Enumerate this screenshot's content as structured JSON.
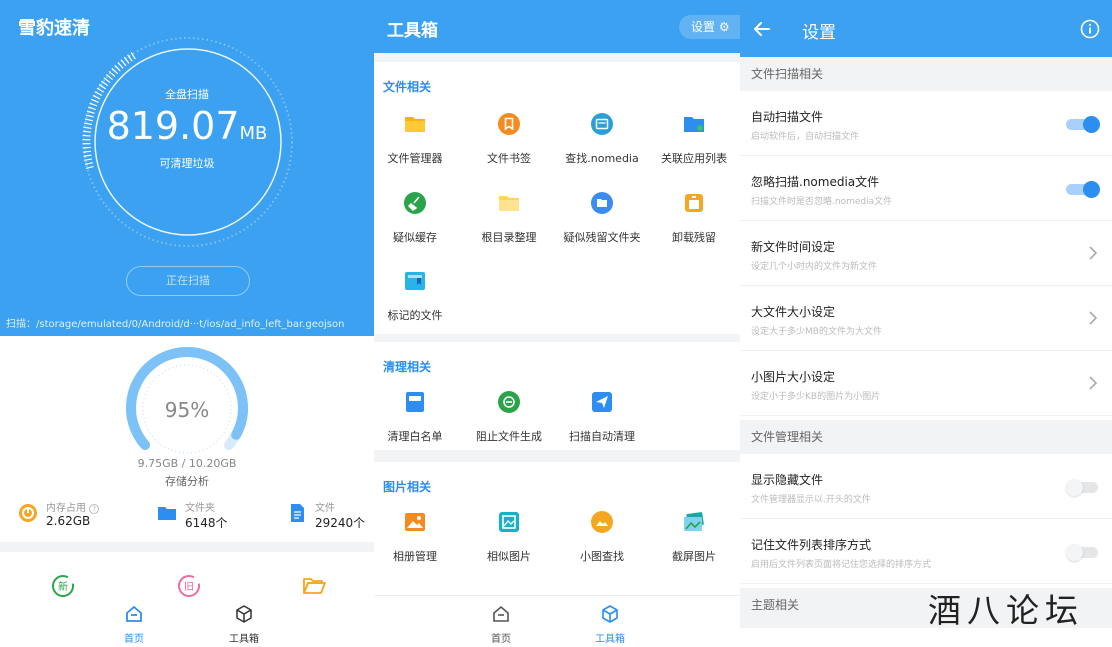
{
  "home": {
    "app_title": "雪豹速清",
    "scan_label": "全盘扫描",
    "scan_size_value": "819.07",
    "scan_size_unit": "MB",
    "scan_sub": "可清理垃圾",
    "scan_button": "正在扫描",
    "scan_path": "扫描：/storage/emulated/0/Android/d···t/ios/ad_info_left_bar.geojson",
    "storage_percent": "95%",
    "storage_fill": 0.95,
    "storage_size": "9.75GB / 10.20GB",
    "storage_label": "存储分析",
    "stats": [
      {
        "label": "内存占用",
        "value": "2.62GB"
      },
      {
        "label": "文件夹",
        "value": "6148个"
      },
      {
        "label": "文件",
        "value": "29240个"
      }
    ],
    "features": [
      {
        "icon": "new-files-icon",
        "label": "新"
      },
      {
        "icon": "old-files-icon",
        "label": "旧"
      },
      {
        "icon": "folder-open-icon",
        "label": ""
      }
    ],
    "nav": [
      {
        "label": "首页",
        "active": true
      },
      {
        "label": "工具箱",
        "active": false
      }
    ]
  },
  "toolbox": {
    "title": "工具箱",
    "settings_label": "设置",
    "sections": [
      {
        "title": "文件相关",
        "tools": [
          "文件管理器",
          "文件书签",
          "查找.nomedia",
          "关联应用列表",
          "疑似缓存",
          "根目录整理",
          "疑似残留文件夹",
          "卸载残留",
          "标记的文件"
        ]
      },
      {
        "title": "清理相关",
        "tools": [
          "清理白名单",
          "阻止文件生成",
          "扫描自动清理"
        ]
      },
      {
        "title": "图片相关",
        "tools": [
          "相册管理",
          "相似图片",
          "小图查找",
          "截屏图片"
        ]
      }
    ],
    "nav": [
      {
        "label": "首页",
        "active": false
      },
      {
        "label": "工具箱",
        "active": true
      }
    ]
  },
  "settings": {
    "title": "设置",
    "categories": [
      {
        "title": "文件扫描相关",
        "rows": [
          {
            "title": "自动扫描文件",
            "desc": "启动软件后，自动扫描文件",
            "control": "toggle",
            "on": true
          },
          {
            "title": "忽略扫描.nomedia文件",
            "desc": "扫描文件时是否忽略.nomedia文件",
            "control": "toggle",
            "on": true
          },
          {
            "title": "新文件时间设定",
            "desc": "设定几个小时内的文件为新文件",
            "control": "chevron"
          },
          {
            "title": "大文件大小设定",
            "desc": "设定大于多少MB的文件为大文件",
            "control": "chevron"
          },
          {
            "title": "小图片大小设定",
            "desc": "设定小于多少KB的图片为小图片",
            "control": "chevron"
          }
        ]
      },
      {
        "title": "文件管理相关",
        "rows": [
          {
            "title": "显示隐藏文件",
            "desc": "文件管理器显示以.开头的文件",
            "control": "toggle",
            "on": false
          },
          {
            "title": "记住文件列表排序方式",
            "desc": "启用后文件列表页面将记住您选择的排序方式",
            "control": "toggle",
            "on": false
          }
        ]
      },
      {
        "title": "主题相关",
        "rows": []
      }
    ]
  },
  "watermark": "酒八论坛",
  "colors": {
    "primary": "#3ba1f0",
    "accent": "#2b8ef0",
    "toggle_on": "#2b8ef0",
    "background": "#f2f3f5"
  }
}
